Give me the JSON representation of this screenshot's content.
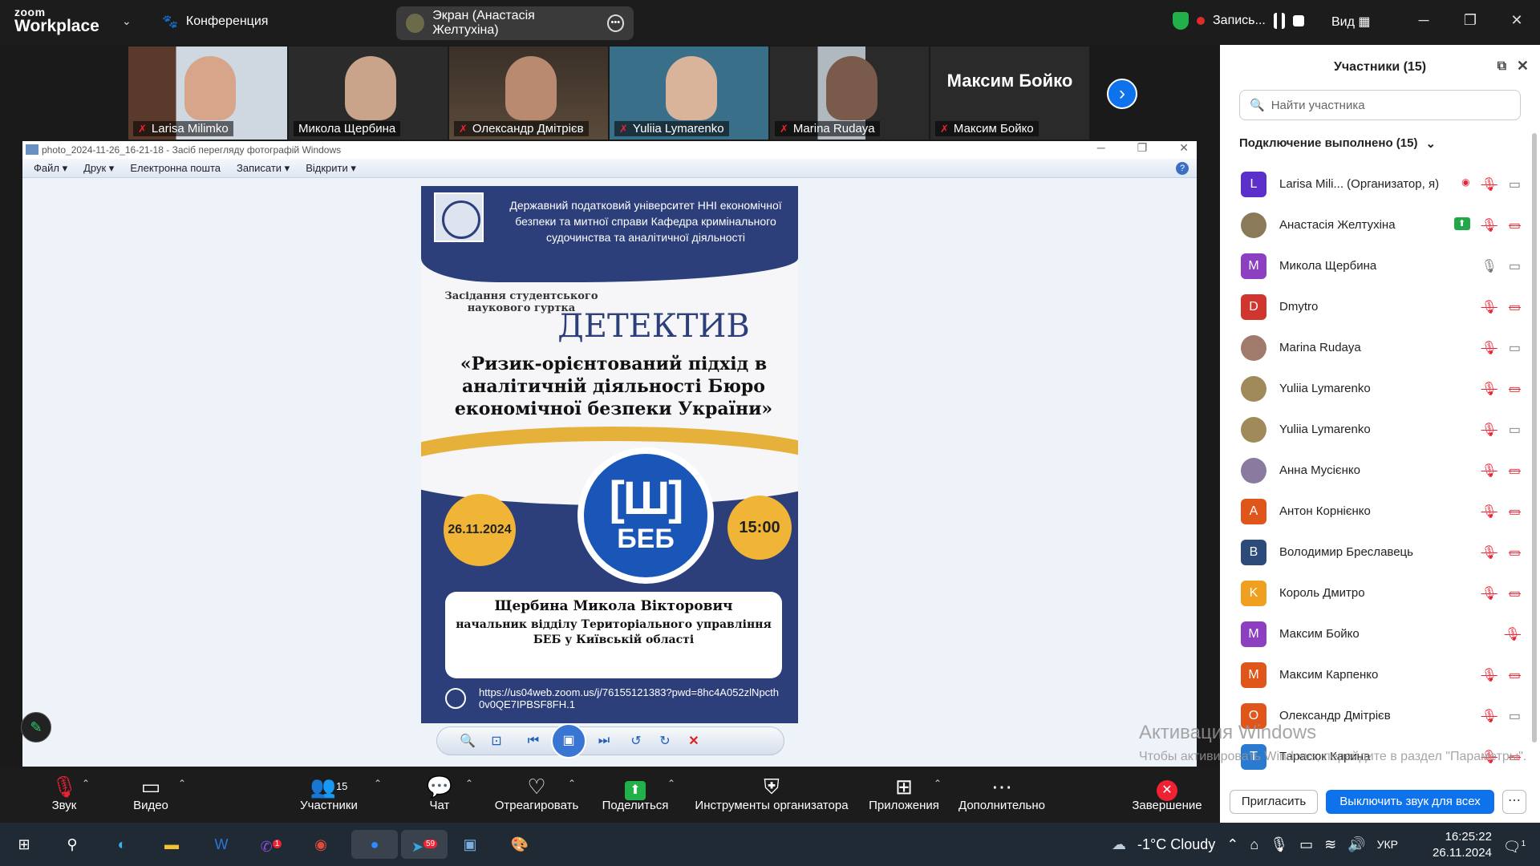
{
  "zoom": {
    "logo_line1": "zoom",
    "logo_line2": "Workplace",
    "conference": "Конференция",
    "share_label": "Экран (Анастасія Желтухіна)",
    "recording": "Запись...",
    "view": "Вид"
  },
  "strip": {
    "tiles": [
      {
        "name": "Larisa Milimko"
      },
      {
        "name": "Микола Щербина"
      },
      {
        "name": "Олександр Дмітрієв"
      },
      {
        "name": "Yuliia Lymarenko"
      },
      {
        "name": "Marina Rudaya"
      },
      {
        "name": "Максим Бойко",
        "big_name": "Максим Бойко"
      }
    ]
  },
  "viewer": {
    "title": "photo_2024-11-26_16-21-18 - Засіб перегляду фотографій Windows",
    "menu": [
      "Файл",
      "Друк",
      "Електронна пошта",
      "Записати",
      "Відкрити"
    ]
  },
  "poster": {
    "org": "Державний податковий університет ННІ економічної безпеки та митної справи Кафедра кримінального судочинства та аналітичної діяльності",
    "subtitle": "Засідання студентського наукового гуртка",
    "detective": "ДЕТЕКТИВ",
    "theme": "«Ризик-орієнтований підхід в аналітичній діяльності Бюро економічної безпеки України»",
    "logo_mark": "[Ш]",
    "logo_text": "БЕБ",
    "date": "26.11.2024",
    "time": "15:00",
    "speaker_name": "Щербина Микола Вікторович",
    "speaker_role": "начальник відділу Територіального управління БЕБ у Київській області",
    "link": "https://us04web.zoom.us/j/76155121383?pwd=8hc4A052zlNpcth0v0QE7IPBSF8FH.1"
  },
  "panel": {
    "title": "Участники (15)",
    "search_placeholder": "Найти участника",
    "group": "Подключение выполнено (15)",
    "participants": [
      {
        "initial": "L",
        "name": "Larisa Mili...  (Организатор, я)",
        "color": "#5b2fc9"
      },
      {
        "initial": "",
        "name": "Анастасія Желтухіна",
        "color": "#8b7a5a"
      },
      {
        "initial": "M",
        "name": "Микола Щербина",
        "color": "#8c3fc0"
      },
      {
        "initial": "D",
        "name": "Dmytro",
        "color": "#d0352e"
      },
      {
        "initial": "",
        "name": "Marina Rudaya",
        "color": "#a07a6a"
      },
      {
        "initial": "",
        "name": "Yuliia Lymarenko",
        "color": "#a08a5a"
      },
      {
        "initial": "",
        "name": "Yuliia Lymarenko",
        "color": "#a08a5a"
      },
      {
        "initial": "",
        "name": "Анна Мусієнко",
        "color": "#8a7aa0"
      },
      {
        "initial": "A",
        "name": "Антон Корнієнко",
        "color": "#e0561a"
      },
      {
        "initial": "B",
        "name": "Володимир Бреславець",
        "color": "#2c4a7a"
      },
      {
        "initial": "K",
        "name": "Король Дмитро",
        "color": "#f0a020"
      },
      {
        "initial": "M",
        "name": "Максим Бойко",
        "color": "#8c3fc0"
      },
      {
        "initial": "M",
        "name": "Максим Карпенко",
        "color": "#e0561a"
      },
      {
        "initial": "O",
        "name": "Олександр Дмітрієв",
        "color": "#e0561a"
      },
      {
        "initial": "T",
        "name": "Тарасюк Карина",
        "color": "#2a7ad0"
      }
    ],
    "invite": "Пригласить",
    "mute_all": "Выключить звук для всех"
  },
  "activation": {
    "line1": "Активация Windows",
    "line2": "Чтобы активировать Windows, перейдите в раздел \"Параметры\"."
  },
  "toolbar": {
    "audio": "Звук",
    "video": "Видео",
    "participants": "Участники",
    "participants_count": "15",
    "chat": "Чат",
    "react": "Отреагировать",
    "share": "Поделиться",
    "host_tools": "Инструменты организатора",
    "apps": "Приложения",
    "more": "Дополнительно",
    "end": "Завершение"
  },
  "taskbar": {
    "weather": "-1°C  Cloudy",
    "lang": "УКР",
    "time": "16:25:22",
    "date": "26.11.2024",
    "notif": "1",
    "viber_badge": "1",
    "telegram_badge": "59"
  }
}
